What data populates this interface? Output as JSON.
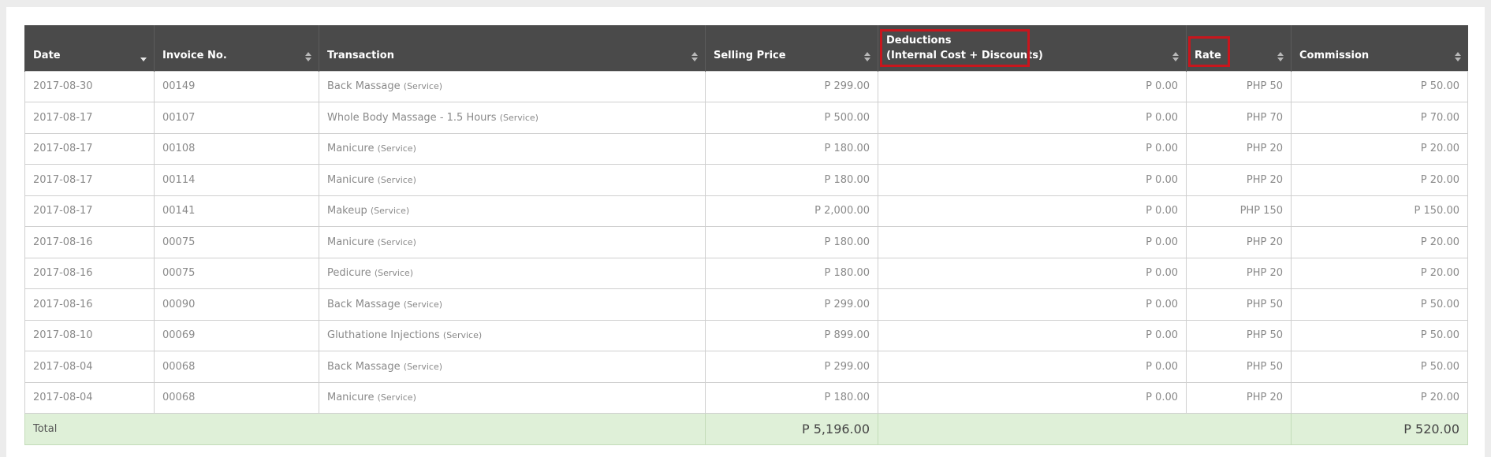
{
  "columns": [
    {
      "key": "date",
      "label": "Date",
      "sort": "desc"
    },
    {
      "key": "invoice",
      "label": "Invoice No.",
      "sort": "both"
    },
    {
      "key": "transaction",
      "label": "Transaction",
      "sort": "both"
    },
    {
      "key": "selling_price",
      "label": "Selling Price",
      "sort": "both"
    },
    {
      "key": "deductions",
      "label": "Deductions",
      "label2": "(Internal Cost + Discounts)",
      "sort": "both"
    },
    {
      "key": "rate",
      "label": "Rate",
      "sort": "both"
    },
    {
      "key": "commission",
      "label": "Commission",
      "sort": "both"
    }
  ],
  "rows": [
    {
      "date": "2017-08-30",
      "invoice": "00149",
      "item": "Back Massage",
      "type": "(Service)",
      "selling_price": "P 299.00",
      "deductions": "P 0.00",
      "rate": "PHP 50",
      "commission": "P 50.00"
    },
    {
      "date": "2017-08-17",
      "invoice": "00107",
      "item": "Whole Body Massage - 1.5 Hours",
      "type": "(Service)",
      "selling_price": "P 500.00",
      "deductions": "P 0.00",
      "rate": "PHP 70",
      "commission": "P 70.00"
    },
    {
      "date": "2017-08-17",
      "invoice": "00108",
      "item": "Manicure",
      "type": "(Service)",
      "selling_price": "P 180.00",
      "deductions": "P 0.00",
      "rate": "PHP 20",
      "commission": "P 20.00"
    },
    {
      "date": "2017-08-17",
      "invoice": "00114",
      "item": "Manicure",
      "type": "(Service)",
      "selling_price": "P 180.00",
      "deductions": "P 0.00",
      "rate": "PHP 20",
      "commission": "P 20.00"
    },
    {
      "date": "2017-08-17",
      "invoice": "00141",
      "item": "Makeup",
      "type": "(Service)",
      "selling_price": "P 2,000.00",
      "deductions": "P 0.00",
      "rate": "PHP 150",
      "commission": "P 150.00"
    },
    {
      "date": "2017-08-16",
      "invoice": "00075",
      "item": "Manicure",
      "type": "(Service)",
      "selling_price": "P 180.00",
      "deductions": "P 0.00",
      "rate": "PHP 20",
      "commission": "P 20.00"
    },
    {
      "date": "2017-08-16",
      "invoice": "00075",
      "item": "Pedicure",
      "type": "(Service)",
      "selling_price": "P 180.00",
      "deductions": "P 0.00",
      "rate": "PHP 20",
      "commission": "P 20.00"
    },
    {
      "date": "2017-08-16",
      "invoice": "00090",
      "item": "Back Massage",
      "type": "(Service)",
      "selling_price": "P 299.00",
      "deductions": "P 0.00",
      "rate": "PHP 50",
      "commission": "P 50.00"
    },
    {
      "date": "2017-08-10",
      "invoice": "00069",
      "item": "Gluthatione Injections",
      "type": "(Service)",
      "selling_price": "P 899.00",
      "deductions": "P 0.00",
      "rate": "PHP 50",
      "commission": "P 50.00"
    },
    {
      "date": "2017-08-04",
      "invoice": "00068",
      "item": "Back Massage",
      "type": "(Service)",
      "selling_price": "P 299.00",
      "deductions": "P 0.00",
      "rate": "PHP 50",
      "commission": "P 50.00"
    },
    {
      "date": "2017-08-04",
      "invoice": "00068",
      "item": "Manicure",
      "type": "(Service)",
      "selling_price": "P 180.00",
      "deductions": "P 0.00",
      "rate": "PHP 20",
      "commission": "P 20.00"
    }
  ],
  "totals": {
    "label": "Total",
    "selling_price": "P 5,196.00",
    "commission": "P 520.00"
  },
  "colors": {
    "header_bg": "#4a4a4a",
    "highlight": "#c8161d",
    "total_bg": "#dff0d8"
  }
}
